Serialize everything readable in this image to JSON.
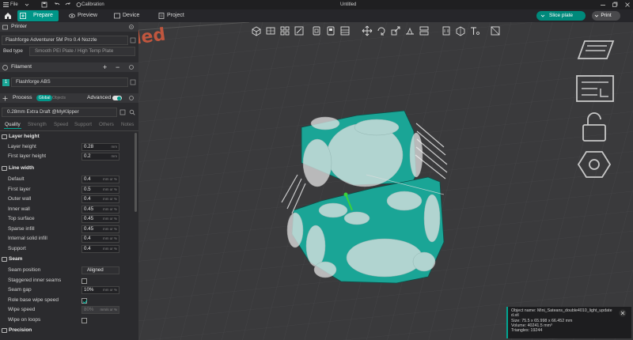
{
  "titlebar": {
    "file_label": "File",
    "calibration_label": "Calibration",
    "window_title": "Untitled"
  },
  "nav": {
    "tabs": [
      {
        "label": "Prepare"
      },
      {
        "label": "Preview"
      },
      {
        "label": "Device"
      },
      {
        "label": "Project"
      }
    ],
    "slice_label": "Slice plate",
    "print_label": "Print"
  },
  "printer": {
    "section_label": "Printer",
    "name": "Flashforge Adventurer 5M Pro 0.4 Nozzle",
    "bed_type_label": "Bed type",
    "bed_type_value": "Smooth PEI Plate / High Temp Plate"
  },
  "filament": {
    "section_label": "Filament",
    "index": "1",
    "name": "Flashforge ABS"
  },
  "process": {
    "section_label": "Process",
    "global_label": "Global",
    "objects_label": "Objects",
    "advanced_label": "Advanced",
    "preset": "0.28mm Extra Draft @MyKlipper",
    "tabs": [
      "Quality",
      "Strength",
      "Speed",
      "Support",
      "Others",
      "Notes"
    ]
  },
  "quality": {
    "layer_height_group": "Layer height",
    "layer_height_label": "Layer height",
    "layer_height_value": "0.28",
    "first_layer_height_label": "First layer height",
    "first_layer_height_value": "0.2",
    "unit_mm": "mm",
    "unit_mm_or_pct": "mm or %",
    "unit_mms_or_pct": "mm/s or %",
    "line_width_group": "Line width",
    "line_widths": [
      {
        "label": "Default",
        "value": "0.4"
      },
      {
        "label": "First layer",
        "value": "0.5"
      },
      {
        "label": "Outer wall",
        "value": "0.4"
      },
      {
        "label": "Inner wall",
        "value": "0.45"
      },
      {
        "label": "Top surface",
        "value": "0.45"
      },
      {
        "label": "Sparse infill",
        "value": "0.45"
      },
      {
        "label": "Internal solid infill",
        "value": "0.4"
      },
      {
        "label": "Support",
        "value": "0.4"
      }
    ],
    "seam_group": "Seam",
    "seam_position_label": "Seam position",
    "seam_position_value": "Aligned",
    "staggered_label": "Staggered inner seams",
    "seam_gap_label": "Seam gap",
    "seam_gap_value": "10%",
    "role_wipe_label": "Role base wipe speed",
    "wipe_speed_label": "Wipe speed",
    "wipe_speed_value": "80%",
    "wipe_loops_label": "Wipe on loops",
    "precision_group": "Precision"
  },
  "viewport": {
    "watermark": "led",
    "accent": "#009688",
    "model_color": "#1aa596"
  },
  "object_info": {
    "name_line": "Object name: Mini_Sateans_double4010_light_update",
    "name_cont": "d.stl",
    "size_line": "Size: 75.5 x 65.998 x 66.452 mm",
    "volume_line": "Volume: 40241.5 mm³",
    "triangles_line": "Triangles: 19244"
  }
}
